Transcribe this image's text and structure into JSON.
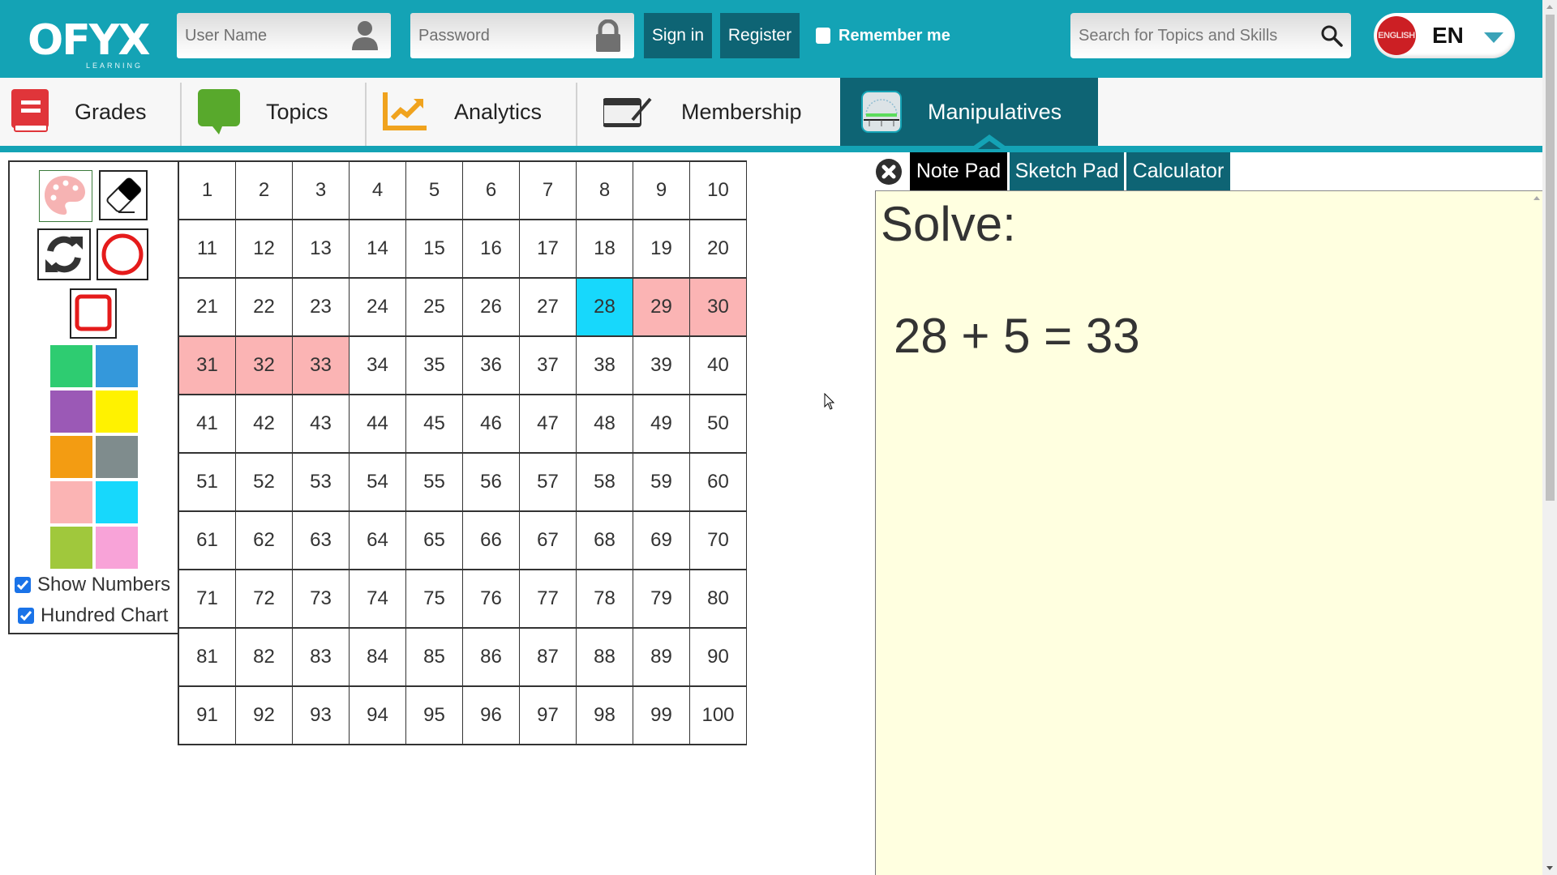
{
  "header": {
    "logo_text": "OFYX",
    "logo_subtext": "LEARNING",
    "username_placeholder": "User Name",
    "password_placeholder": "Password",
    "signin_label": "Sign in",
    "register_label": "Register",
    "remember_label": "Remember me",
    "remember_checked": false,
    "search_placeholder": "Search for Topics and Skills",
    "language_flag_text": "ENGLISH",
    "language_code": "EN"
  },
  "nav": {
    "items": [
      {
        "label": "Grades",
        "icon": "book-icon"
      },
      {
        "label": "Topics",
        "icon": "speech-bubble-icon"
      },
      {
        "label": "Analytics",
        "icon": "line-chart-icon"
      },
      {
        "label": "Membership",
        "icon": "tablet-pen-icon"
      },
      {
        "label": "Manipulatives",
        "icon": "protractor-icon",
        "active": true
      }
    ]
  },
  "tools": {
    "buttons": [
      "palette-icon",
      "eraser-icon",
      "refresh-icon",
      "circle-icon",
      "square-icon"
    ],
    "swatches": [
      "#2ecc71",
      "#3498db",
      "#9b59b6",
      "#fff200",
      "#f39c12",
      "#7f8c8d",
      "#fbb4b4",
      "#17d8fc",
      "#a0c83c",
      "#f8a3d8"
    ],
    "show_numbers_label": "Show Numbers",
    "show_numbers_checked": true,
    "hundred_chart_label": "Hundred Chart",
    "hundred_chart_checked": true
  },
  "chart": {
    "numbers_start": 1,
    "numbers_end": 100,
    "highlight_colors": {
      "28": "#17d8fc",
      "29": "#fbb4b4",
      "30": "#fbb4b4",
      "31": "#fbb4b4",
      "32": "#fbb4b4",
      "33": "#fbb4b4"
    }
  },
  "notepad": {
    "tabs": [
      {
        "label": "Note Pad",
        "active": true
      },
      {
        "label": "Sketch Pad"
      },
      {
        "label": "Calculator"
      }
    ],
    "heading": "Solve:",
    "equation": "28 + 5 = 33"
  },
  "colors": {
    "brand_teal": "#14a3b5",
    "dark_teal": "#0e6474",
    "notepad_bg": "#ffffe0"
  }
}
